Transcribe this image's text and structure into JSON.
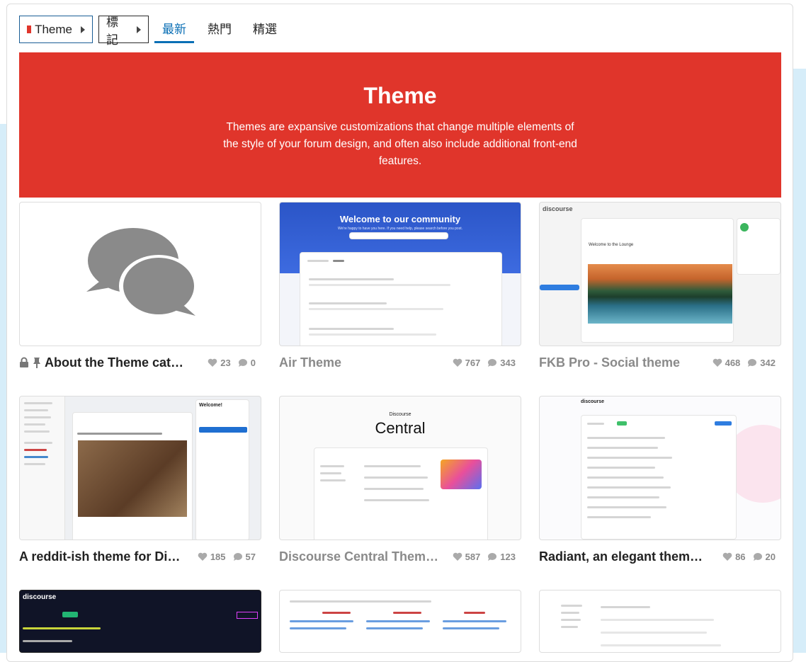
{
  "nav": {
    "category_dropdown": "Theme",
    "tags_dropdown": "標記",
    "tabs": [
      {
        "label": "最新",
        "active": true
      },
      {
        "label": "熱門",
        "active": false
      },
      {
        "label": "精選",
        "active": false
      }
    ]
  },
  "hero": {
    "title": "Theme",
    "description": "Themes are expansive customizations that change multiple elements of the style of your forum design, and often also include additional front-end features.",
    "color": "#e0352b"
  },
  "accent": "#0a6fb5",
  "topics": [
    {
      "title": "About the Theme cat…",
      "likes": "23",
      "replies": "0",
      "locked": true,
      "pinned": true,
      "read": false
    },
    {
      "title": "Air Theme",
      "likes": "767",
      "replies": "343",
      "read": true
    },
    {
      "title": "FKB Pro - Social theme",
      "likes": "468",
      "replies": "342",
      "read": true
    },
    {
      "title": "A reddit-ish theme for Di…",
      "likes": "185",
      "replies": "57",
      "read": false
    },
    {
      "title": "Discourse Central Them…",
      "likes": "587",
      "replies": "123",
      "read": true
    },
    {
      "title": "Radiant, an elegant them…",
      "likes": "86",
      "replies": "20",
      "read": false
    }
  ],
  "thumbs": {
    "air_heading": "Welcome to our community",
    "air_sub": "We're happy to have you here. If you need help, please search before you post.",
    "fkb_post_title": "Welcome to the Lounge",
    "central_small": "Discourse",
    "central_big": "Central",
    "logo_text": "discourse",
    "welcome_label": "Welcome!"
  }
}
